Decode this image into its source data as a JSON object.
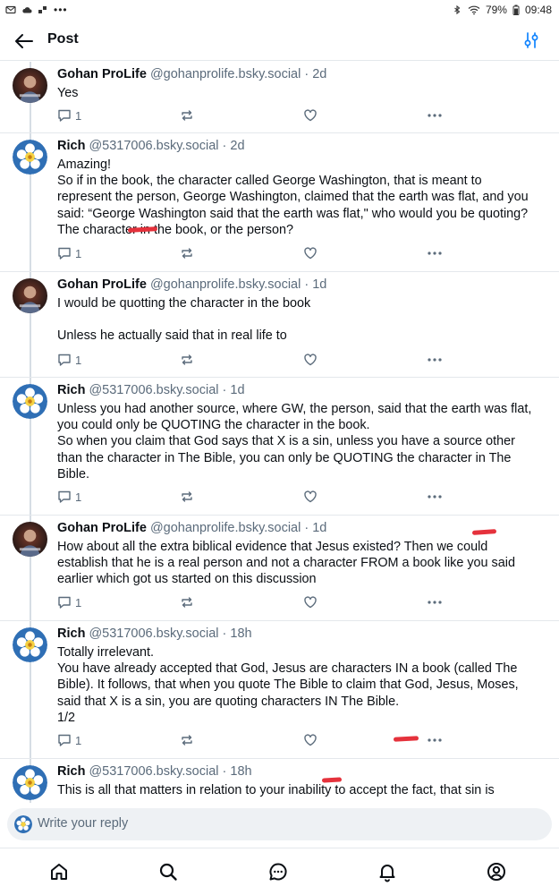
{
  "status_bar": {
    "battery": "79%",
    "time": "09:48"
  },
  "header": {
    "title": "Post"
  },
  "colors": {
    "accent": "#1083fe",
    "text": "#0b0f14",
    "muted": "#5b6b7b",
    "annotation": "#e5323c"
  },
  "posts": [
    {
      "author": "Gohan ProLife",
      "handle": "@gohanprolife.bsky.social",
      "time": "· 2d",
      "avatar": "gohan-avatar",
      "lines": [
        "Yes"
      ],
      "reply_count": "1"
    },
    {
      "author": "Rich",
      "handle": "@5317006.bsky.social",
      "time": "· 2d",
      "avatar": "rose-avatar",
      "lines": [
        "Amazing!",
        "So if in the book, the character called George Washington, that is meant to",
        "represent the person, George Washington, claimed that the earth was flat, and you",
        "said: “George Washington said that the earth was flat,\" who would you be quoting?",
        "The character in the book, or the person?"
      ],
      "reply_count": "1"
    },
    {
      "author": "Gohan ProLife",
      "handle": "@gohanprolife.bsky.social",
      "time": "· 1d",
      "avatar": "gohan-avatar",
      "lines": [
        "I would be quotting the character in the book",
        "",
        "Unless he actually said that in real life to"
      ],
      "reply_count": "1"
    },
    {
      "author": "Rich",
      "handle": "@5317006.bsky.social",
      "time": "· 1d",
      "avatar": "rose-avatar",
      "lines": [
        "Unless you had another source, where GW, the person, said that the earth was flat,",
        "you could only be QUOTING the character in the book.",
        "So when you claim that God says that X is a sin, unless you have a source other",
        "than the character in The Bible, you can only be QUOTING the character in The",
        "Bible."
      ],
      "reply_count": "1"
    },
    {
      "author": "Gohan ProLife",
      "handle": "@gohanprolife.bsky.social",
      "time": "· 1d",
      "avatar": "gohan-avatar",
      "lines": [
        "How about all the extra biblical evidence that Jesus existed? Then we could",
        "establish that he is a real person and not a character FROM a book like you said",
        "earlier which got us started on this discussion"
      ],
      "reply_count": "1"
    },
    {
      "author": "Rich",
      "handle": "@5317006.bsky.social",
      "time": "· 18h",
      "avatar": "rose-avatar",
      "lines": [
        "Totally irrelevant.",
        "You have already accepted that God, Jesus are characters IN a book (called The",
        "Bible). It follows, that when you quote The Bible to claim that God, Jesus, Moses,",
        "said that X is a sin, you are quoting characters IN The Bible.",
        "1/2"
      ],
      "reply_count": "1"
    },
    {
      "author": "Rich",
      "handle": "@5317006.bsky.social",
      "time": "· 18h",
      "avatar": "rose-avatar",
      "lines": [
        "This is all that matters in relation to your inability to accept the fact, that sin is"
      ],
      "reply_count": ""
    }
  ],
  "reply_bar": {
    "placeholder": "Write your reply"
  },
  "bottom_nav": [
    "home-icon",
    "search-icon",
    "chat-icon",
    "bell-icon",
    "profile-icon"
  ]
}
